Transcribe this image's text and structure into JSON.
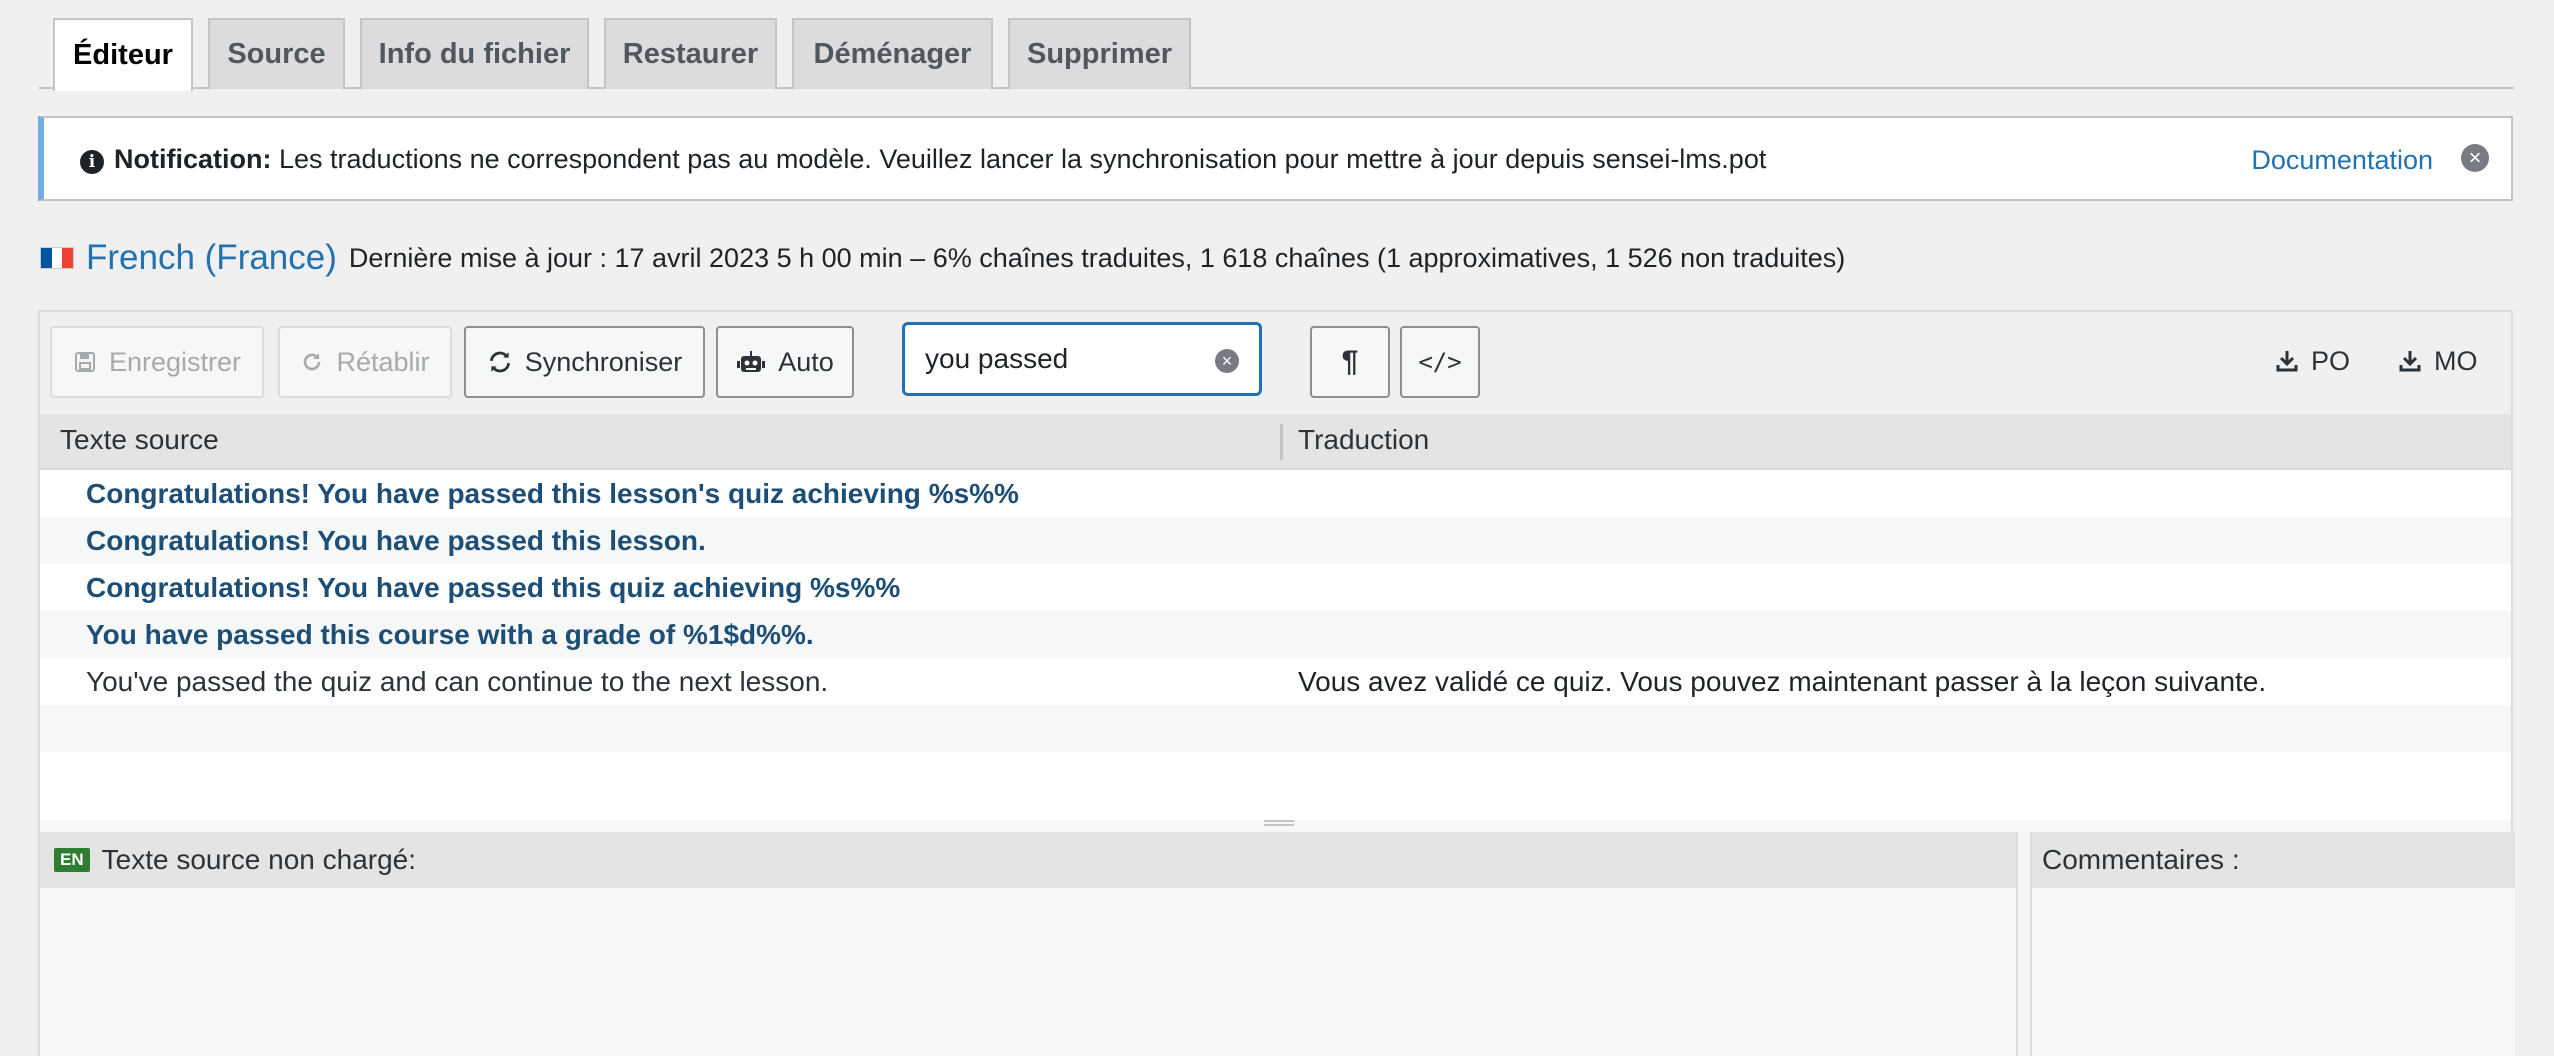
{
  "tabs": [
    {
      "label": "Éditeur",
      "active": true
    },
    {
      "label": "Source"
    },
    {
      "label": "Info du fichier"
    },
    {
      "label": "Restaurer"
    },
    {
      "label": "Déménager"
    },
    {
      "label": "Supprimer"
    }
  ],
  "notice": {
    "title": "Notification:",
    "message": "Les traductions ne correspondent pas au modèle. Veuillez lancer la synchronisation pour mettre à jour depuis sensei-lms.pot",
    "link": "Documentation",
    "icon": "info-icon",
    "accent": "#72aee6"
  },
  "heading": {
    "language": "French (France)",
    "stats": "Dernière mise à jour : 17 avril 2023 5 h 00 min – 6% chaînes traduites, 1 618 chaînes (1 approximatives, 1 526 non traduites)"
  },
  "toolbar": {
    "save": "Enregistrer",
    "revert": "Rétablir",
    "sync": "Synchroniser",
    "auto": "Auto",
    "search_value": "you passed",
    "download_po": "PO",
    "download_mo": "MO"
  },
  "columns": {
    "source": "Texte source",
    "translation": "Traduction"
  },
  "rows": [
    {
      "source": "Congratulations! You have passed this lesson's quiz achieving %s%%",
      "translation": ""
    },
    {
      "source": "Congratulations! You have passed this lesson.",
      "translation": ""
    },
    {
      "source": "Congratulations! You have passed this quiz achieving %s%%",
      "translation": ""
    },
    {
      "source": "You have passed this course with a grade of %1$d%%.",
      "translation": ""
    },
    {
      "source": "You've passed the quiz and can continue to the next lesson.",
      "translation": "Vous avez validé ce quiz. Vous pouvez maintenant passer à la leçon suivante."
    }
  ],
  "source_pane": {
    "badge": "EN",
    "title": "Texte source non chargé:"
  },
  "comments_pane": {
    "title": "Commentaires :"
  },
  "colors": {
    "link": "#2271b1",
    "untranslated_text": "#1d4e75",
    "en_badge": "#2e7d32"
  }
}
